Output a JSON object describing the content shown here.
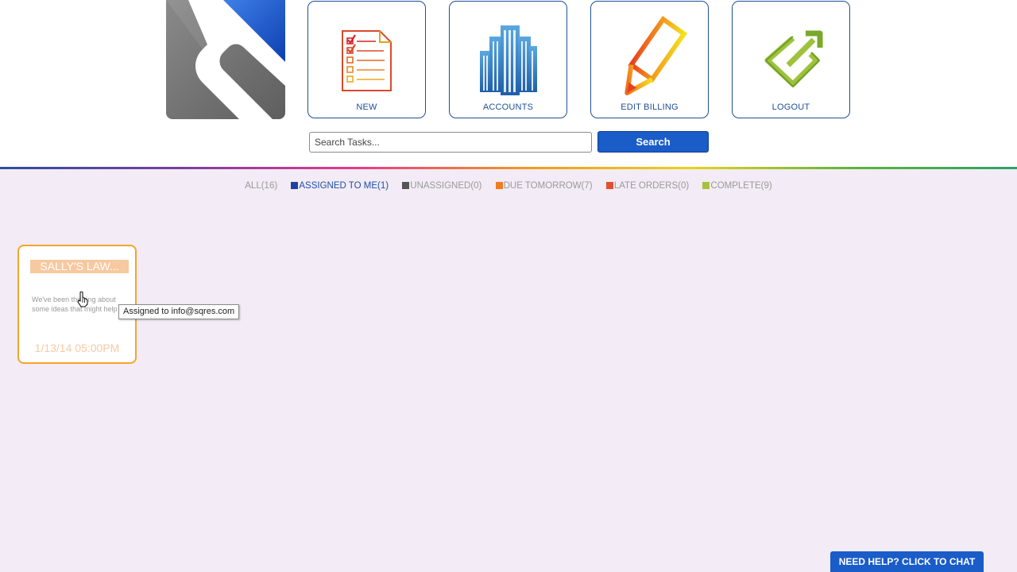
{
  "nav": {
    "tiles": [
      {
        "label": "NEW",
        "icon": "task-list-icon"
      },
      {
        "label": "ACCOUNTS",
        "icon": "buildings-icon"
      },
      {
        "label": "EDIT BILLING",
        "icon": "pencil-icon"
      },
      {
        "label": "LOGOUT",
        "icon": "logout-arrow-icon"
      }
    ]
  },
  "search": {
    "placeholder": "Search Tasks...",
    "value": "",
    "button_label": "Search"
  },
  "filters": [
    {
      "label": "ALL(16)",
      "color": "#9a9a9a",
      "swatch": ""
    },
    {
      "label": "ASSIGNED TO ME(1)",
      "color": "#1f4fa8",
      "swatch": "#1f3fa8"
    },
    {
      "label": "UNASSIGNED(0)",
      "color": "#9a9a9a",
      "swatch": "#555555"
    },
    {
      "label": "DUE TOMORROW(7)",
      "color": "#9a9a9a",
      "swatch": "#f07c1e"
    },
    {
      "label": "LATE ORDERS(0)",
      "color": "#9a9a9a",
      "swatch": "#e0522e"
    },
    {
      "label": "COMPLETE(9)",
      "color": "#9a9a9a",
      "swatch": "#a6c23a"
    }
  ],
  "task_card": {
    "title": "SALLY'S LAW...",
    "description": "We've been thinking about some ideas that might help",
    "date": "1/13/14 05:00PM",
    "border_color": "#f4a52a"
  },
  "tooltip": {
    "text": "Assigned to info@sqres.com"
  },
  "chat": {
    "label": "NEED HELP? CLICK TO CHAT"
  }
}
